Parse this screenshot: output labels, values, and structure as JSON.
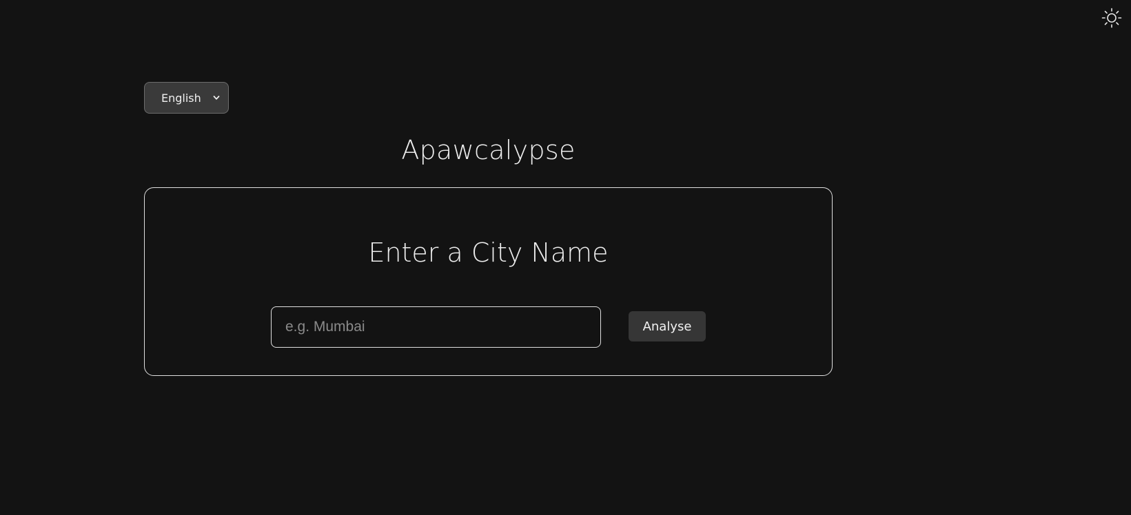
{
  "theme_toggle": {
    "icon": "sun-icon",
    "color": "#e6e6e6"
  },
  "language_select": {
    "selected": "English"
  },
  "header": {
    "title": "Apawcalypse"
  },
  "search_card": {
    "heading": "Enter a City Name",
    "input_value": "",
    "input_placeholder": "e.g. Mumbai",
    "submit_label": "Analyse"
  },
  "colors": {
    "background": "#131313",
    "border": "#e0e0e0",
    "button_bg": "#363636",
    "select_bg": "#3a3a3a"
  }
}
